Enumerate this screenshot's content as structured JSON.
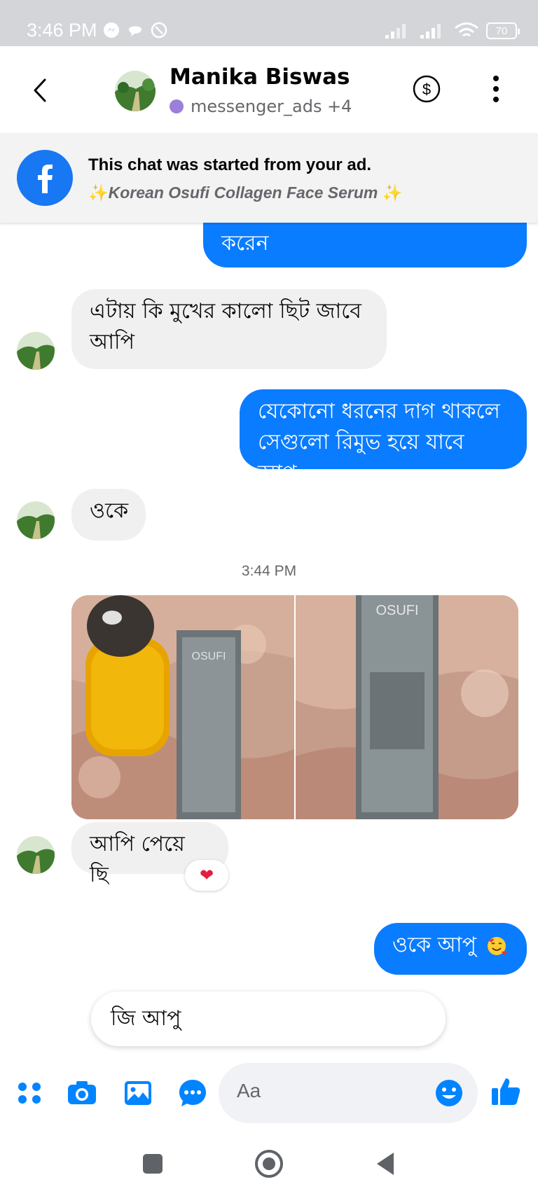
{
  "status_bar": {
    "time": "3:46 PM",
    "battery": "70"
  },
  "header": {
    "name": "Manika Biswas",
    "subtitle": "messenger_ads +4"
  },
  "ad_banner": {
    "title": "This chat was started from your ad.",
    "product": "Korean Osufi Collagen Face Serum"
  },
  "messages": [
    {
      "side": "out",
      "text": "করেন"
    },
    {
      "side": "in",
      "lines": [
        "এটায় কি মুখের কালো ছিট জাবে",
        "আপি"
      ]
    },
    {
      "side": "out",
      "lines": [
        "যেকোনো ধরনের দাগ থাকলে",
        "সেগুলো রিমুভ হয়ে যাবে আপু"
      ]
    },
    {
      "side": "in",
      "text": "ওকে"
    },
    {
      "side": "timestamp",
      "text": "3:44 PM"
    },
    {
      "side": "in",
      "type": "photos",
      "count": 2,
      "label": "OSUFI"
    },
    {
      "side": "in",
      "text": "আপি পেয়ে ছি",
      "reaction": "heart"
    },
    {
      "side": "out",
      "text": "ওকে আপু",
      "emoji": "smiling-face-with-hearts"
    }
  ],
  "suggested_reply": "জি আপু",
  "composer": {
    "placeholder": "Aa"
  },
  "colors": {
    "accent": "#0084ff",
    "out_bubble": "#0a7cff",
    "in_bubble": "#f0f0f0"
  }
}
